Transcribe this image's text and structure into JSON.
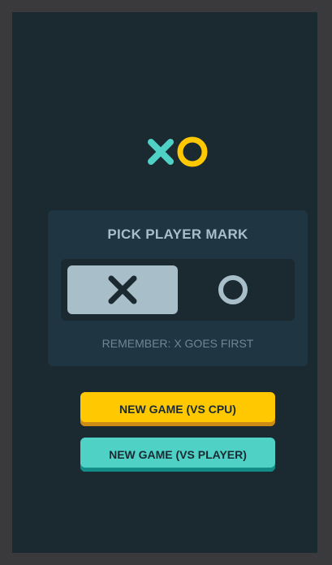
{
  "app": {
    "logo_icons": [
      "x-logo-icon",
      "o-logo-icon"
    ]
  },
  "colors": {
    "background": "#1b2931",
    "panel": "#1f3541",
    "silver": "#a8bfc9",
    "cyan": "#4fd1c5",
    "yellow": "#ffc800",
    "dark_navy": "#1a2a33"
  },
  "pick_mark": {
    "title": "PICK PLAYER MARK",
    "options": [
      {
        "mark": "X",
        "icon": "x-icon",
        "selected": true
      },
      {
        "mark": "O",
        "icon": "o-icon",
        "selected": false
      }
    ],
    "reminder": "REMEMBER: X GOES FIRST"
  },
  "buttons": {
    "new_game_cpu": "NEW GAME (VS CPU)",
    "new_game_player": "NEW GAME (VS PLAYER)"
  }
}
